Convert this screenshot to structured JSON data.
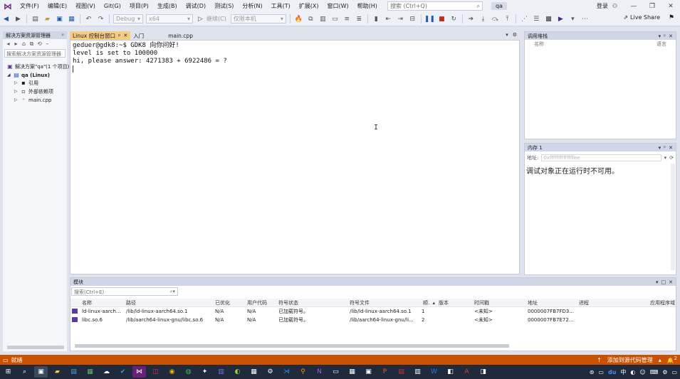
{
  "menubar": {
    "items": [
      "文件(F)",
      "编辑(E)",
      "视图(V)",
      "Git(G)",
      "项目(P)",
      "生成(B)",
      "调试(D)",
      "测试(S)",
      "分析(N)",
      "工具(T)",
      "扩展(X)",
      "窗口(W)",
      "帮助(H)"
    ],
    "search_placeholder": "搜索 (Ctrl+Q)",
    "solution_name": "qa",
    "login": "登录"
  },
  "toolbar": {
    "config": "Debug",
    "platform": "x64",
    "continue": "继续(C)",
    "target": "仅限本机",
    "live_share": "Live Share"
  },
  "solution_explorer": {
    "title": "解决方案资源管理器",
    "search_placeholder": "搜索解决方案资源管理器",
    "items": [
      {
        "label": "解决方案\"qa\"(1 个项目)"
      },
      {
        "label": "qa (Linux)"
      },
      {
        "label": "引用"
      },
      {
        "label": "外部依赖项"
      },
      {
        "label": "main.cpp"
      }
    ]
  },
  "editor": {
    "tabs": [
      {
        "label": "Linux 控制台窗口",
        "pin": "ᵖ",
        "close": "✕"
      },
      {
        "label": "入门"
      },
      {
        "label": "main.cpp"
      }
    ],
    "terminal_lines": [
      "geduer@gdk8:~$ GDK8 向你问好!",
      "level is set to 100000",
      "hi, please answer: 4271383 + 6922486 = ?"
    ]
  },
  "call_stack": {
    "title": "调用堆栈",
    "col_name": "名称",
    "col_lang": "语言"
  },
  "memory": {
    "title": "内存 1",
    "addr_label": "地址:",
    "addr_value": "0xffffffffffffffee",
    "message": "调试对象正在运行时不可用。"
  },
  "modules": {
    "title": "模块",
    "search_placeholder": "搜索(Ctrl+E)",
    "headers": [
      "名称",
      "路径",
      "已优化",
      "用户代码",
      "符号状态",
      "符号文件",
      "顺.",
      "版本",
      "时间戳",
      "地址",
      "进程",
      "应用程序域"
    ],
    "rows": [
      [
        "ld-linux-aarch...",
        "/lib/ld-linux-aarch64.so.1",
        "N/A",
        "N/A",
        "已加载符号。",
        "/lib/ld-linux-aarch64.so.1",
        "1",
        "",
        "<未知>",
        "0000007FB7FD3...",
        "",
        ""
      ],
      [
        "libc.so.6",
        "/lib/aarch64-linux-gnu/libc.so.6",
        "N/A",
        "N/A",
        "已加载符号。",
        "/lib/aarch64-linux-gnu/li...",
        "2",
        "",
        "<未知>",
        "0000007FB7E72...",
        "",
        ""
      ]
    ]
  },
  "status": {
    "left": "就绪",
    "right": "添加到源代码管理",
    "notif_count": "2"
  },
  "taskbar": {
    "ime": "中"
  }
}
